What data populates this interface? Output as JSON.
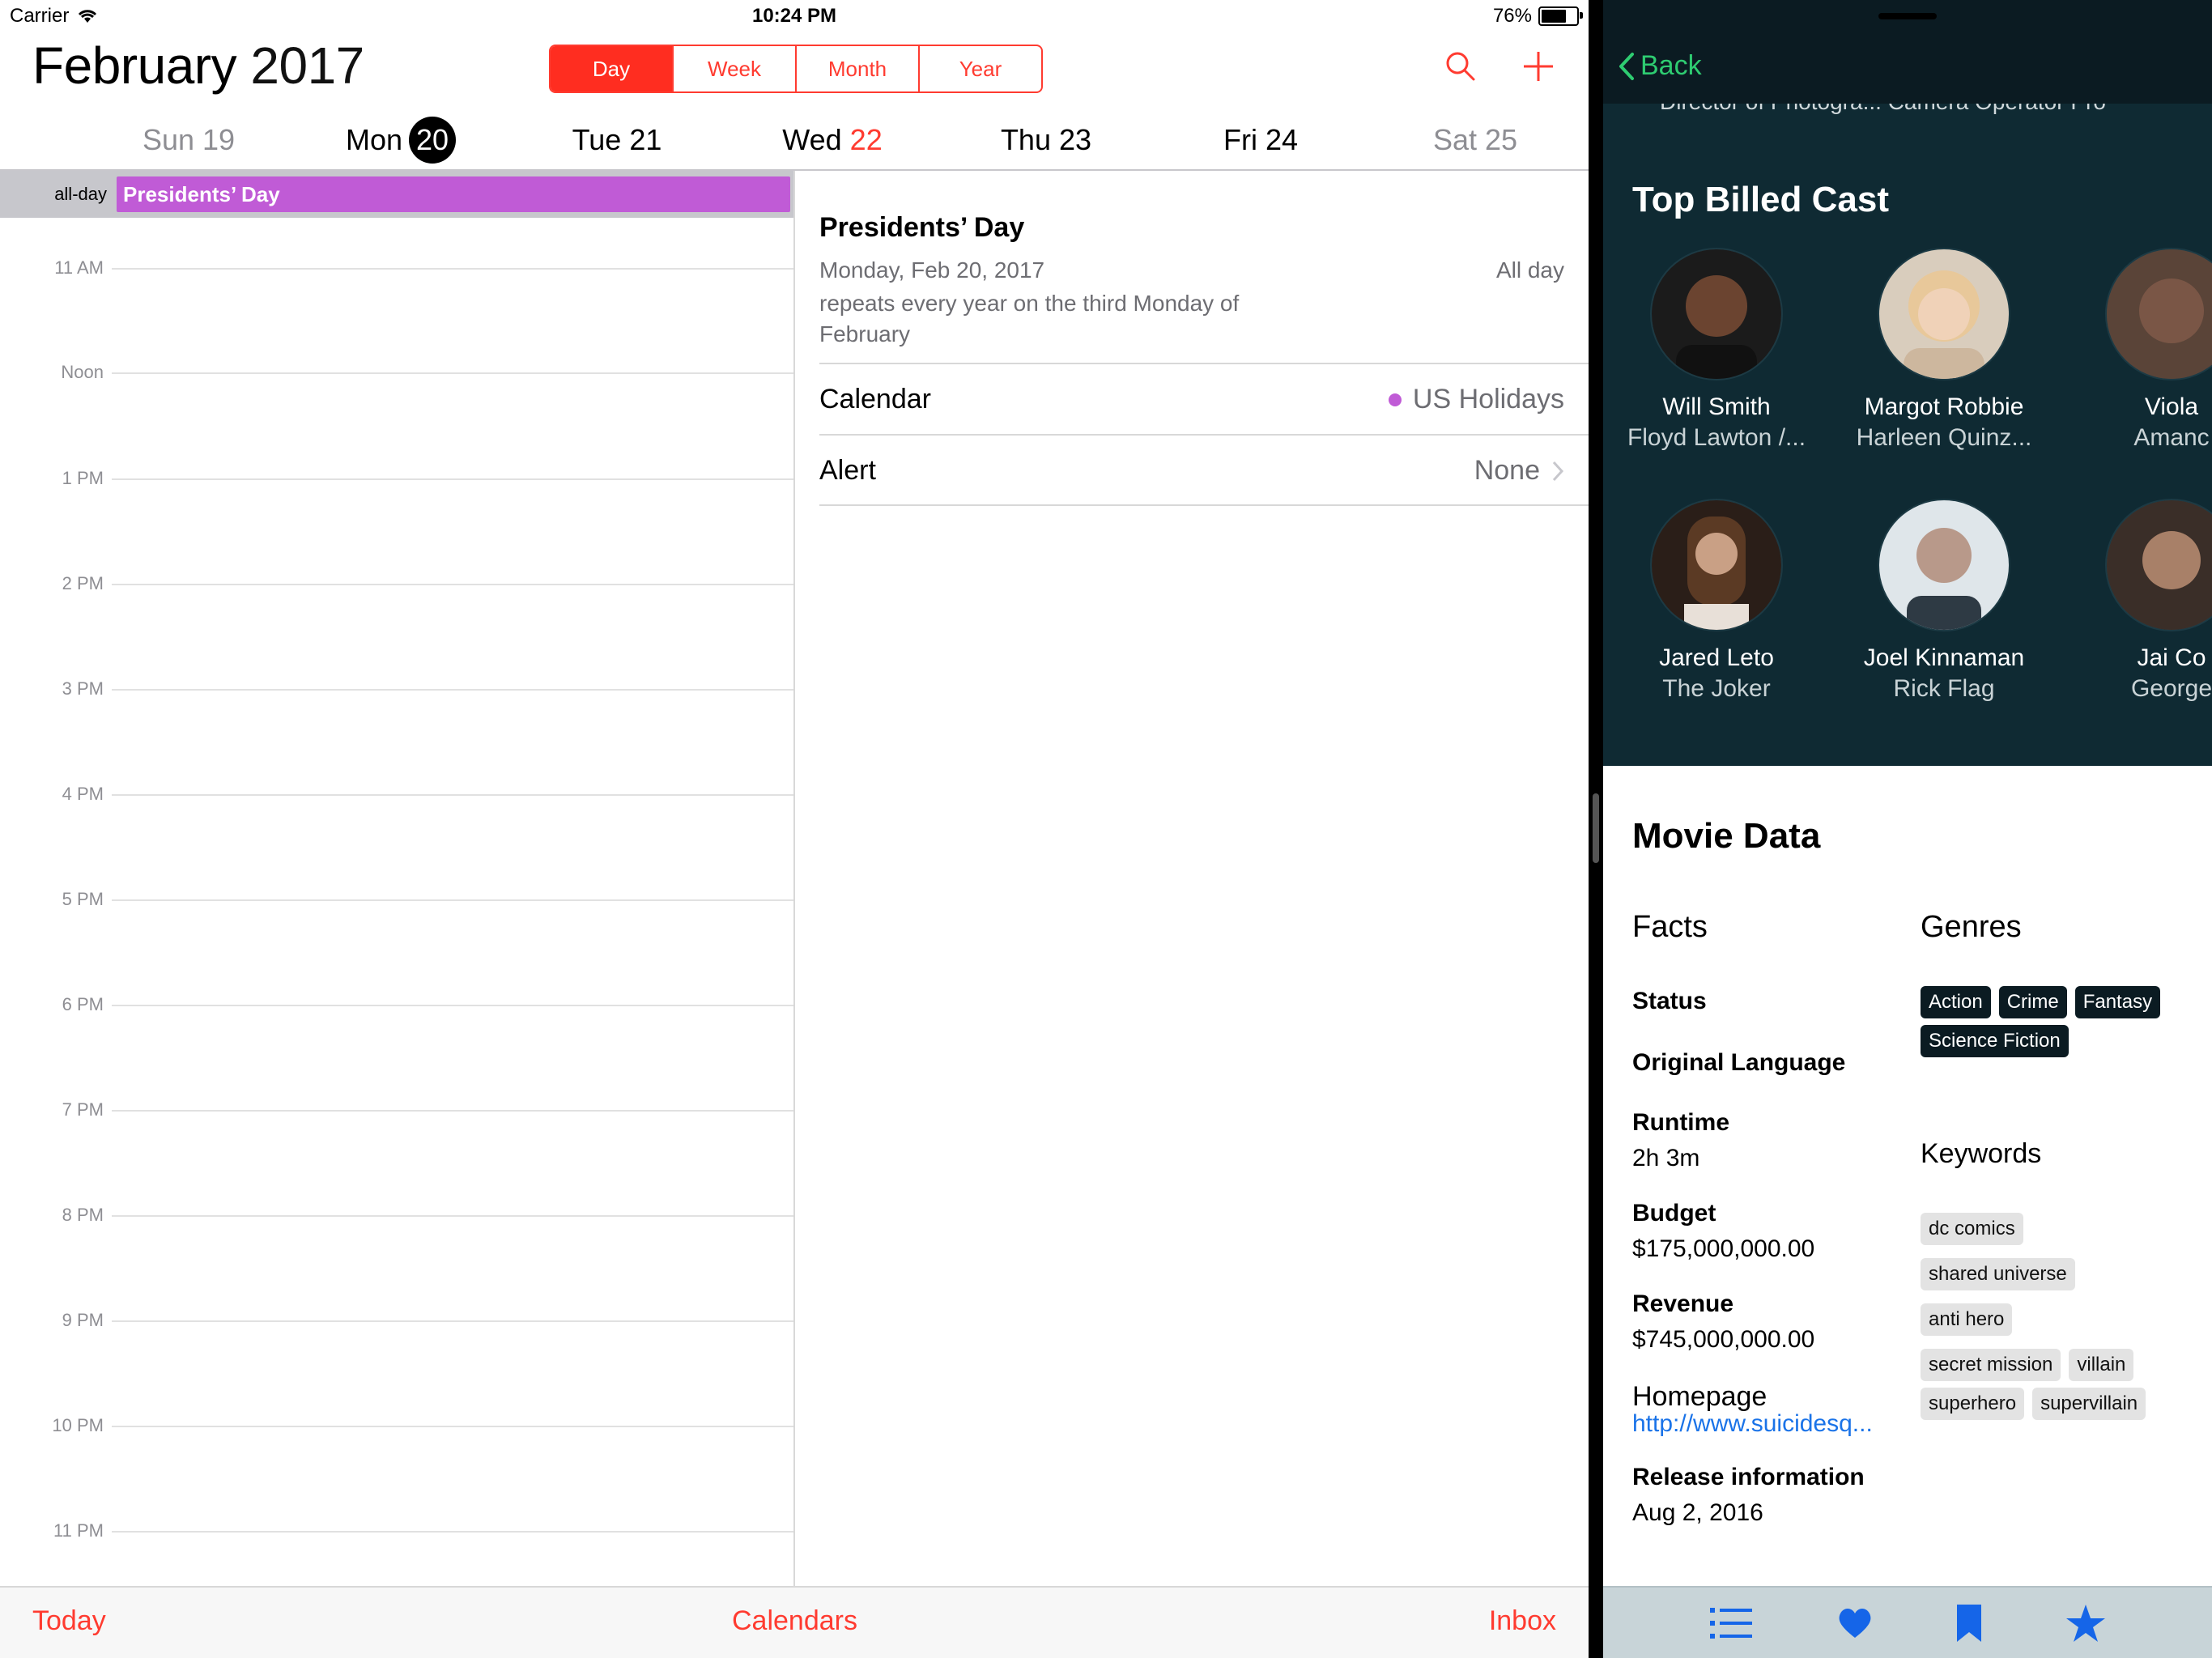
{
  "status": {
    "carrier": "Carrier",
    "time": "10:24 PM",
    "battery": "76%"
  },
  "calendar": {
    "month": "February",
    "year": "2017",
    "segments": [
      "Day",
      "Week",
      "Month",
      "Year"
    ],
    "week": [
      {
        "dow": "Sun",
        "num": "19"
      },
      {
        "dow": "Mon",
        "num": "20"
      },
      {
        "dow": "Tue",
        "num": "21"
      },
      {
        "dow": "Wed",
        "num": "22"
      },
      {
        "dow": "Thu",
        "num": "23"
      },
      {
        "dow": "Fri",
        "num": "24"
      },
      {
        "dow": "Sat",
        "num": "25"
      }
    ],
    "allday_label": "all-day",
    "allday_event": "Presidents’ Day",
    "hours": [
      "11 AM",
      "Noon",
      "1 PM",
      "2 PM",
      "3 PM",
      "4 PM",
      "5 PM",
      "6 PM",
      "7 PM",
      "8 PM",
      "9 PM",
      "10 PM",
      "11 PM"
    ],
    "detail": {
      "title": "Presidents’ Day",
      "date": "Monday, Feb 20, 2017",
      "allday": "All day",
      "repeat": "repeats every year on the third Monday of February",
      "calendar_label": "Calendar",
      "calendar_value": "US Holidays",
      "alert_label": "Alert",
      "alert_value": "None"
    },
    "tabs": {
      "today": "Today",
      "calendars": "Calendars",
      "inbox": "Inbox"
    },
    "colors": {
      "accent": "#ff3b30",
      "event": "#c05bd6"
    }
  },
  "movie": {
    "back": "Back",
    "crew_cut": "Director of Photogra...   Camera Operator         Pro",
    "cast_title": "Top Billed Cast",
    "cast": [
      {
        "name": "Will Smith",
        "role": "Floyd Lawton /..."
      },
      {
        "name": "Margot Robbie",
        "role": "Harleen Quinz..."
      },
      {
        "name": "Viola",
        "role": "Amanc"
      },
      {
        "name": "Jared Leto",
        "role": "The Joker"
      },
      {
        "name": "Joel Kinnaman",
        "role": "Rick Flag"
      },
      {
        "name": "Jai Co",
        "role": "George"
      }
    ],
    "data_title": "Movie Data",
    "facts_heading": "Facts",
    "facts": {
      "status_label": "Status",
      "language_label": "Original Language",
      "runtime_label": "Runtime",
      "runtime_value": "2h 3m",
      "budget_label": "Budget",
      "budget_value": "$175,000,000.00",
      "revenue_label": "Revenue",
      "revenue_value": "$745,000,000.00",
      "homepage_label": "Homepage",
      "homepage_value": "http://www.suicidesq...",
      "release_label": "Release information",
      "release_value": "Aug 2, 2016"
    },
    "genres_heading": "Genres",
    "genres": [
      "Action",
      "Crime",
      "Fantasy",
      "Science Fiction"
    ],
    "keywords_heading": "Keywords",
    "keywords": [
      "dc comics",
      "shared universe",
      "anti hero",
      "secret mission",
      "villain",
      "superhero",
      "supervillain"
    ],
    "tab_icons": [
      "list-icon",
      "heart-icon",
      "bookmark-icon",
      "star-icon"
    ],
    "colors": {
      "accent": "#2ecc71",
      "dark": "#0f2a33",
      "link": "#1a73e8",
      "tab_icon": "#1565e8"
    }
  }
}
